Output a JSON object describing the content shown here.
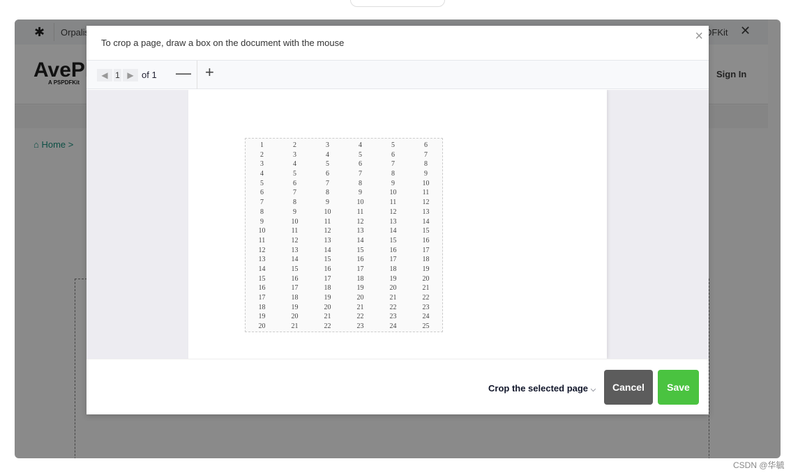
{
  "app": {
    "brand": "Orpalis",
    "brand_right": "DFKit",
    "logo_text": "AvePDF",
    "logo_sub": "A PSPDFKit",
    "sign_in": "Sign In",
    "breadcrumb_home": "Home",
    "breadcrumb_sep": ">"
  },
  "modal": {
    "title": "To crop a page, draw a box on the document with the mouse",
    "close": "×",
    "toolbar": {
      "prev": "◀",
      "page": "1",
      "next": "▶",
      "of": "of 1",
      "zoom_out": "—",
      "zoom_in": "+"
    },
    "table_rows": [
      [
        1,
        2,
        3,
        4,
        5,
        6
      ],
      [
        2,
        3,
        4,
        5,
        6,
        7
      ],
      [
        3,
        4,
        5,
        6,
        7,
        8
      ],
      [
        4,
        5,
        6,
        7,
        8,
        9
      ],
      [
        5,
        6,
        7,
        8,
        9,
        10
      ],
      [
        6,
        7,
        8,
        9,
        10,
        11
      ],
      [
        7,
        8,
        9,
        10,
        11,
        12
      ],
      [
        8,
        9,
        10,
        11,
        12,
        13
      ],
      [
        9,
        10,
        11,
        12,
        13,
        14
      ],
      [
        10,
        11,
        12,
        13,
        14,
        15
      ],
      [
        11,
        12,
        13,
        14,
        15,
        16
      ],
      [
        12,
        13,
        14,
        15,
        16,
        17
      ],
      [
        13,
        14,
        15,
        16,
        17,
        18
      ],
      [
        14,
        15,
        16,
        17,
        18,
        19
      ],
      [
        15,
        16,
        17,
        18,
        19,
        20
      ],
      [
        16,
        17,
        18,
        19,
        20,
        21
      ],
      [
        17,
        18,
        19,
        20,
        21,
        22
      ],
      [
        18,
        19,
        20,
        21,
        22,
        23
      ],
      [
        19,
        20,
        21,
        22,
        23,
        24
      ],
      [
        20,
        21,
        22,
        23,
        24,
        25
      ]
    ],
    "crop_mode": "Crop the selected page",
    "cancel": "Cancel",
    "save": "Save"
  },
  "watermark": "CSDN @华毓"
}
